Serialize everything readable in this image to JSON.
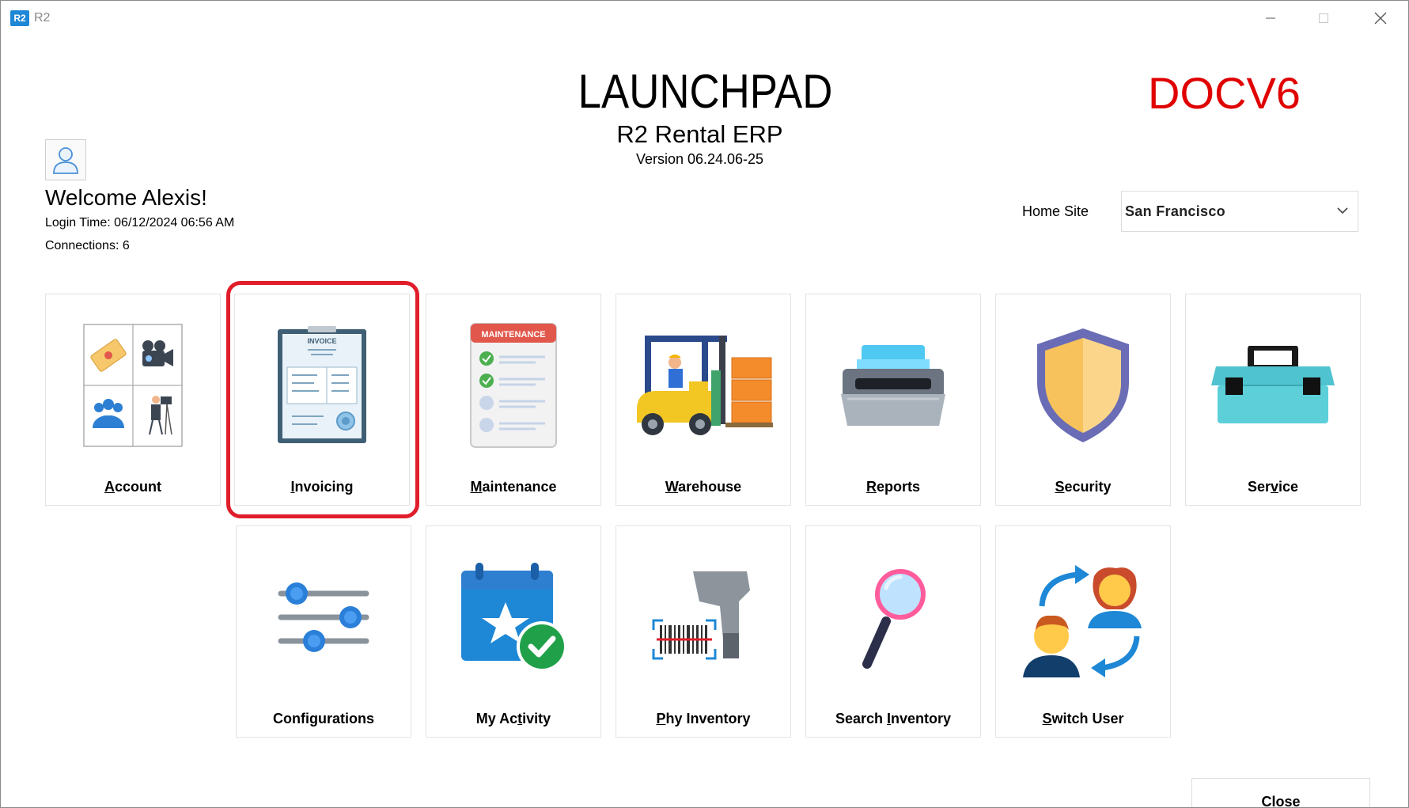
{
  "window": {
    "logo_text": "R2",
    "title": "R2"
  },
  "header": {
    "title": "LAUNCHPAD",
    "product": "R2 Rental ERP",
    "version": "Version 06.24.06-25",
    "environment": "DOCV6",
    "environment_color": "#e00000"
  },
  "user": {
    "welcome": "Welcome Alexis!",
    "login_time": "Login Time: 06/12/2024 06:56 AM",
    "connections": "Connections:  6"
  },
  "home_site": {
    "label": "Home Site",
    "selected": "San Francisco"
  },
  "tiles": [
    {
      "id": "account",
      "key": "A",
      "rest": "ccount",
      "icon": "account-collage-icon"
    },
    {
      "id": "invoicing",
      "key": "I",
      "rest": "nvoicing",
      "icon": "invoice-document-icon",
      "icon_text": "INVOICE",
      "selected": true
    },
    {
      "id": "maintenance",
      "key": "M",
      "rest": "aintenance",
      "icon": "maintenance-checklist-icon",
      "icon_text": "MAINTENANCE"
    },
    {
      "id": "warehouse",
      "key": "W",
      "rest": "arehouse",
      "icon": "forklift-icon"
    },
    {
      "id": "reports",
      "key": "R",
      "rest": "eports",
      "icon": "printer-icon"
    },
    {
      "id": "security",
      "key": "S",
      "rest": "ecurity",
      "icon": "shield-icon"
    },
    {
      "id": "service",
      "pre": "Ser",
      "key": "v",
      "rest": "ice",
      "icon": "toolbox-icon"
    },
    {
      "id": "configurations",
      "label": "Configurations",
      "icon": "sliders-icon"
    },
    {
      "id": "my-activity",
      "pre": "My Ac",
      "key": "t",
      "rest": "ivity",
      "icon": "calendar-check-icon"
    },
    {
      "id": "phy-inventory",
      "key": "P",
      "rest": "hy Inventory",
      "icon": "barcode-scanner-icon"
    },
    {
      "id": "search-inventory",
      "pre": "Search ",
      "key": "I",
      "rest": "nventory",
      "icon": "magnifier-icon"
    },
    {
      "id": "switch-user",
      "key": "S",
      "rest": "witch User",
      "icon": "switch-user-icon"
    }
  ],
  "footer": {
    "close_key": "C",
    "close_rest": "lose"
  },
  "colors": {
    "highlight": "#e01e2b",
    "accent_blue": "#1e88d6"
  }
}
